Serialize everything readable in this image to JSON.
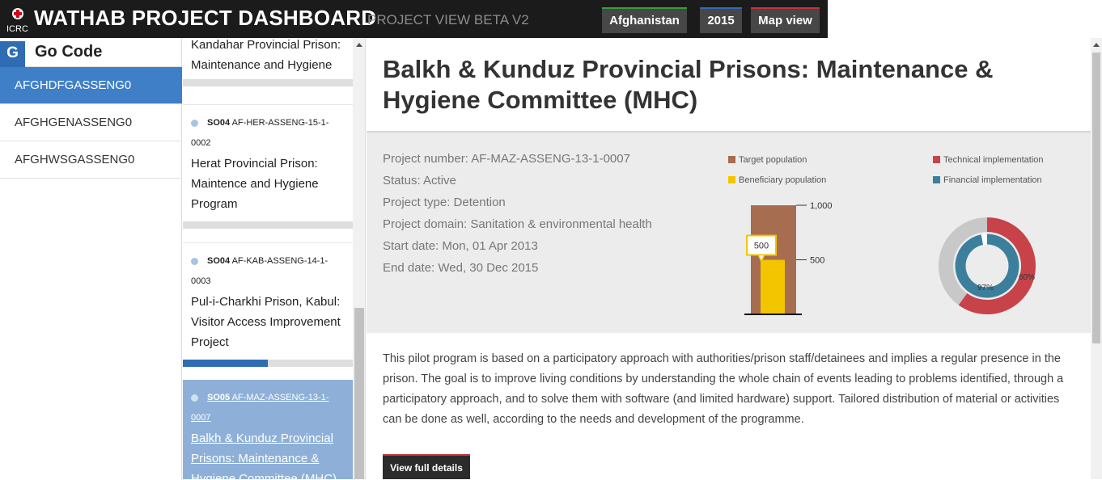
{
  "header": {
    "logo_text": "ICRC",
    "title": "WATHAB PROJECT DASHBOARD",
    "subtitle": "PROJECT VIEW BETA V2",
    "country": "Afghanistan",
    "year": "2015",
    "map_view": "Map view",
    "colors": {
      "country": "#3a9c3a",
      "year": "#2d6bb5",
      "map": "#c9323b"
    }
  },
  "gocode": {
    "badge": "G",
    "title": "Go Code",
    "items": [
      {
        "label": "AFGHDFGASSENG0",
        "active": true
      },
      {
        "label": "AFGHGENASSENG0",
        "active": false
      },
      {
        "label": "AFGHWSGASSENG0",
        "active": false
      }
    ]
  },
  "projects": [
    {
      "name_lines": [
        "Kandahar Provincial Prison:",
        "Maintenance and Hygiene"
      ],
      "progress": 0
    },
    {
      "objective": "SO04",
      "code_lines": [
        "AF-HER-ASSENG-15-1-",
        "0002"
      ],
      "name_lines": [
        "Herat Provincial Prison:",
        "Maintence and Hygiene",
        "Program"
      ],
      "progress": 0
    },
    {
      "objective": "SO04",
      "code_lines": [
        "AF-KAB-ASSENG-14-1-",
        "0003"
      ],
      "name_lines": [
        "Pul-i-Charkhi Prison, Kabul:",
        "Visitor Access Improvement",
        "Project"
      ],
      "progress": 0.5
    },
    {
      "objective": "SO05",
      "code_lines": [
        "AF-MAZ-ASSENG-13-1-",
        "0007"
      ],
      "name_lines": [
        "Balkh & Kunduz Provincial",
        "Prisons: Maintenance &",
        "Hygiene Committee (MHC)"
      ],
      "selected": true
    }
  ],
  "project": {
    "title": "Balkh & Kunduz Provincial Prisons: Maintenance & Hygiene Committee (MHC)",
    "number": "Project number: AF-MAZ-ASSENG-13-1-0007",
    "status": "Status: Active",
    "type": "Project type: Detention",
    "domain": "Project domain: Sanitation & environmental health",
    "start": "Start date: Mon, 01 Apr 2013",
    "end": "End date: Wed, 30 Dec 2015",
    "description": "This pilot program is based on a participatory approach with authorities/prison staff/detainees and implies a regular presence in the prison. The goal is to improve living conditions by understanding the whole chain of events leading to problems identified, through a participatory approach, and to solve them with software (and limited hardware) support. Tailored distribution of material or activities can be done as well, according to the needs and development of the programme.",
    "details_button": "View full details"
  },
  "legend": {
    "target": "Target population",
    "beneficiary": "Beneficiary population",
    "technical": "Technical implementation",
    "financial": "Financial implementation",
    "colors": {
      "target": "#a66d50",
      "beneficiary": "#f2c500",
      "technical": "#c84349",
      "financial": "#3c7f9c"
    }
  },
  "chart_data": [
    {
      "type": "bar",
      "categories": [
        "Population"
      ],
      "series": [
        {
          "name": "Target population",
          "values": [
            1000
          ]
        },
        {
          "name": "Beneficiary population",
          "values": [
            500
          ]
        }
      ],
      "ylim": [
        0,
        1000
      ],
      "yticks": [
        "1,000",
        "500"
      ],
      "annotation": "500"
    },
    {
      "type": "pie",
      "series": [
        {
          "name": "Technical implementation",
          "value": 60,
          "label": "60%"
        },
        {
          "name": "Financial implementation",
          "value": 97,
          "label": "97%"
        }
      ]
    }
  ]
}
